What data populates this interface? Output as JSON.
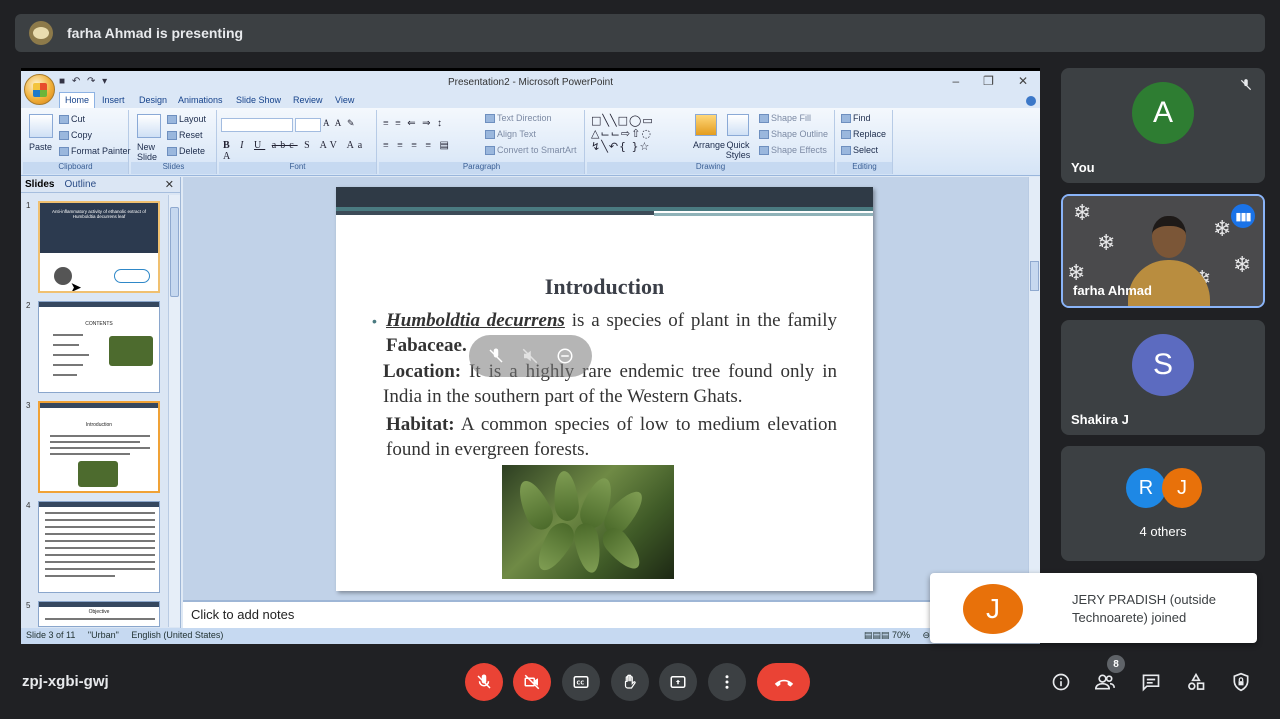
{
  "meet": {
    "presenter_text": "farha Ahmad is presenting",
    "meeting_code": "zpj-xgbi-gwj",
    "participant_count": "8"
  },
  "ppt": {
    "window_title": "Presentation2 - Microsoft PowerPoint",
    "tabs": [
      "Home",
      "Insert",
      "Design",
      "Animations",
      "Slide Show",
      "Review",
      "View"
    ],
    "clipboard": {
      "cut": "Cut",
      "copy": "Copy",
      "paste": "Paste",
      "format_painter": "Format Painter",
      "label": "Clipboard"
    },
    "slides_group": {
      "new_slide": "New Slide",
      "layout": "Layout",
      "reset": "Reset",
      "delete": "Delete",
      "label": "Slides"
    },
    "font_label": "Font",
    "paragraph": {
      "text_direction": "Text Direction",
      "align_text": "Align Text",
      "convert": "Convert to SmartArt",
      "label": "Paragraph"
    },
    "drawing": {
      "arrange": "Arrange",
      "quick_styles": "Quick Styles",
      "shape_fill": "Shape Fill",
      "shape_outline": "Shape Outline",
      "shape_effects": "Shape Effects",
      "label": "Drawing"
    },
    "editing": {
      "find": "Find",
      "replace": "Replace",
      "select": "Select",
      "label": "Editing"
    },
    "pane_tabs": {
      "slides": "Slides",
      "outline": "Outline"
    },
    "thumbnails": [
      {
        "num": "1",
        "title": "Anti-inflammatory activity of ethanolic extract of Humboldtia decurrens leaf"
      },
      {
        "num": "2",
        "title": "CONTENTS"
      },
      {
        "num": "3",
        "title": "Introduction"
      },
      {
        "num": "4",
        "title": ""
      },
      {
        "num": "5",
        "title": "Objective"
      }
    ],
    "slide": {
      "title": "Introduction",
      "para1_italic": "Humboldtia decurrens",
      "para1_rest": " is a species of plant in the family ",
      "para1_bold": "Fabaceae.",
      "location_label": "Location:",
      "location_text": " It is a highly rare endemic tree found only in India in the southern part of the Western Ghats.",
      "habitat_label": "Habitat:",
      "habitat_text": " A common species of low to medium elevation found in evergreen forests."
    },
    "notes_placeholder": "Click to add notes",
    "status": {
      "slide_of": "Slide 3 of 11",
      "theme": "\"Urban\"",
      "language": "English (United States)",
      "zoom": "70%"
    }
  },
  "tiles": [
    {
      "name": "You",
      "initial": "A",
      "color": "#2e7d32"
    },
    {
      "name": "farha Ahmad"
    },
    {
      "name": "Shakira J",
      "initial": "S",
      "color": "#5c6bc0"
    },
    {
      "name": "4 others",
      "initials": [
        "R",
        "J"
      ],
      "colors": [
        "#1e88e5",
        "#e8710a"
      ]
    }
  ],
  "toast": {
    "initial": "J",
    "message": "JERY PRADISH (outside Technoarete) joined"
  },
  "colors": {
    "end_call": "#ea4335",
    "accent": "#1a73e8"
  }
}
